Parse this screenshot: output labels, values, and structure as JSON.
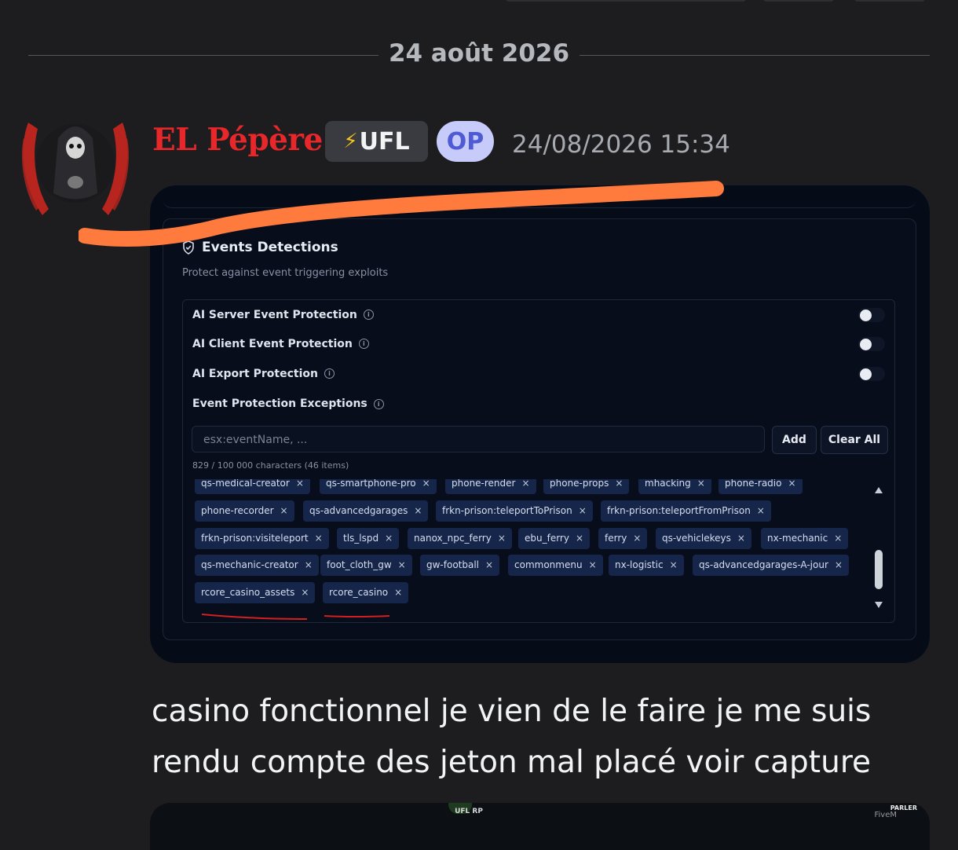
{
  "date_separator": "24 août 2026",
  "message": {
    "author": "EL Pépère",
    "tag_emoji": "⚡",
    "tag": "UFL",
    "op_badge": "OP",
    "timestamp": "24/08/2026 15:34",
    "text": "casino fonctionnel je vien de le faire je me suis rendu compte des jeton mal placé voir capture",
    "colors": {
      "author": "#e8272b",
      "op_badge_bg": "#c6cbf9",
      "annotation": "#ff7a3d"
    }
  },
  "screenshot": {
    "title": "Events Detections",
    "subtitle": "Protect against event triggering exploits",
    "toggles": [
      {
        "label": "AI Server Event Protection",
        "on": false
      },
      {
        "label": "AI Client Event Protection",
        "on": false
      },
      {
        "label": "AI Export Protection",
        "on": false
      }
    ],
    "exceptions_label": "Event Protection Exceptions",
    "input_placeholder": "esx:eventName, ...",
    "add_label": "Add",
    "clear_label": "Clear All",
    "count_text": "829 / 100 000 characters (46 items)",
    "tag_rows": [
      [
        "qs-medical-creator",
        "qs-smartphone-pro",
        "phone-render",
        "phone-props",
        "mhacking",
        "phone-radio"
      ],
      [
        "phone-recorder",
        "qs-advancedgarages",
        "frkn-prison:teleportToPrison",
        "frkn-prison:teleportFromPrison"
      ],
      [
        "frkn-prison:visiteleport",
        "tls_lspd",
        "nanox_npc_ferry",
        "ebu_ferry",
        "ferry",
        "qs-vehiclekeys",
        "nx-mechanic"
      ],
      [
        "qs-mechanic-creator",
        "foot_cloth_gw",
        "gw-football",
        "commonmenu",
        "nx-logistic",
        "qs-advancedgarages-A-jour"
      ],
      [
        "rcore_casino_assets",
        "rcore_casino"
      ]
    ],
    "remove_symbol": "×"
  },
  "bottom_image": {
    "logo_text": "UFL RP",
    "corner_label": "PARLER",
    "corner_text": "FiveM"
  }
}
